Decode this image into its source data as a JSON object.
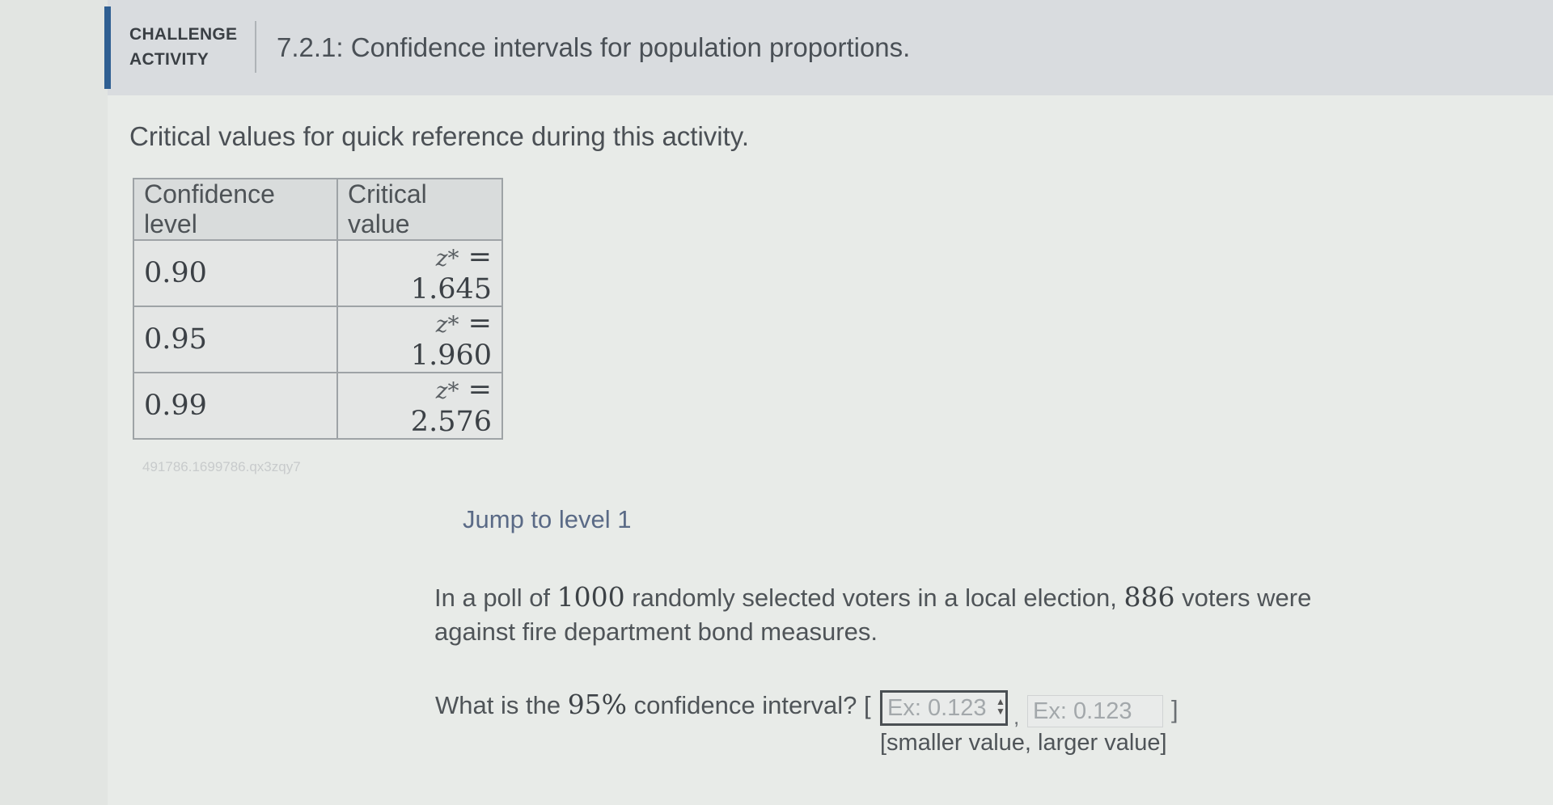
{
  "header": {
    "badge_line1": "CHALLENGE",
    "badge_line2": "ACTIVITY",
    "title": "7.2.1: Confidence intervals for population proportions."
  },
  "intro": "Critical values for quick reference during this activity.",
  "table": {
    "columns": [
      "Confidence level",
      "Critical value"
    ],
    "rows": [
      {
        "level": "0.90",
        "zvar": "z*",
        "eq": " = 1.645"
      },
      {
        "level": "0.95",
        "zvar": "z*",
        "eq": " = 1.960"
      },
      {
        "level": "0.99",
        "zvar": "z*",
        "eq": " = 2.576"
      }
    ]
  },
  "activity_id": "491786.1699786.qx3zqy7",
  "jump_link": "Jump to level 1",
  "problem": {
    "text_1": "In a poll of ",
    "n": "1000",
    "text_2": " randomly selected voters in a local election, ",
    "x": "886",
    "text_3": " voters were against fire department bond measures."
  },
  "question": {
    "text_1": "What is the ",
    "percent": "95%",
    "text_2": " confidence interval? [",
    "open_bracket_end": "",
    "comma": ",",
    "close_bracket": "]",
    "lower_placeholder": "Ex: 0.123",
    "upper_placeholder": "Ex: 0.123",
    "hint": "[smaller value, larger value]"
  }
}
